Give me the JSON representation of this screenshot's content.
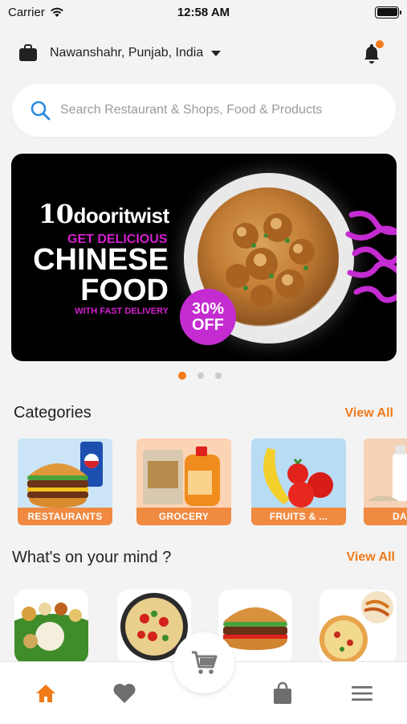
{
  "status_bar": {
    "carrier": "Carrier",
    "time": "12:58 AM"
  },
  "location": {
    "text": "Nawanshahr, Punjab, India",
    "icon": "briefcase-icon",
    "notification_icon": "bell-icon",
    "notification_dot_color": "#f07a1a"
  },
  "search": {
    "placeholder": "Search Restaurant & Shops, Food & Products"
  },
  "banner": {
    "brand_num": "10",
    "brand_name": "dooritwist",
    "tagline": "GET DELICIOUS",
    "headline_1": "CHINESE",
    "headline_2": "FOOD",
    "sub": "WITH FAST DELIVERY",
    "badge_line1": "30%",
    "badge_line2": "OFF"
  },
  "carousel": {
    "pages": 3,
    "active_index": 0
  },
  "categories": {
    "title": "Categories",
    "view_all": "View All",
    "items": [
      {
        "label": "RESTAURANTS"
      },
      {
        "label": "GROCERY"
      },
      {
        "label": "FRUITS & ..."
      },
      {
        "label": "DA"
      }
    ]
  },
  "mind": {
    "title": "What's on your mind ?",
    "view_all": "View All"
  },
  "colors": {
    "accent": "#f07a1a",
    "category_label": "#f08a40",
    "banner_magenta": "#d41fd0"
  },
  "bottom_nav": {
    "items": [
      "home-icon",
      "heart-icon",
      "cart-icon",
      "shopping-bag-icon",
      "menu-icon"
    ],
    "active": "home-icon"
  }
}
